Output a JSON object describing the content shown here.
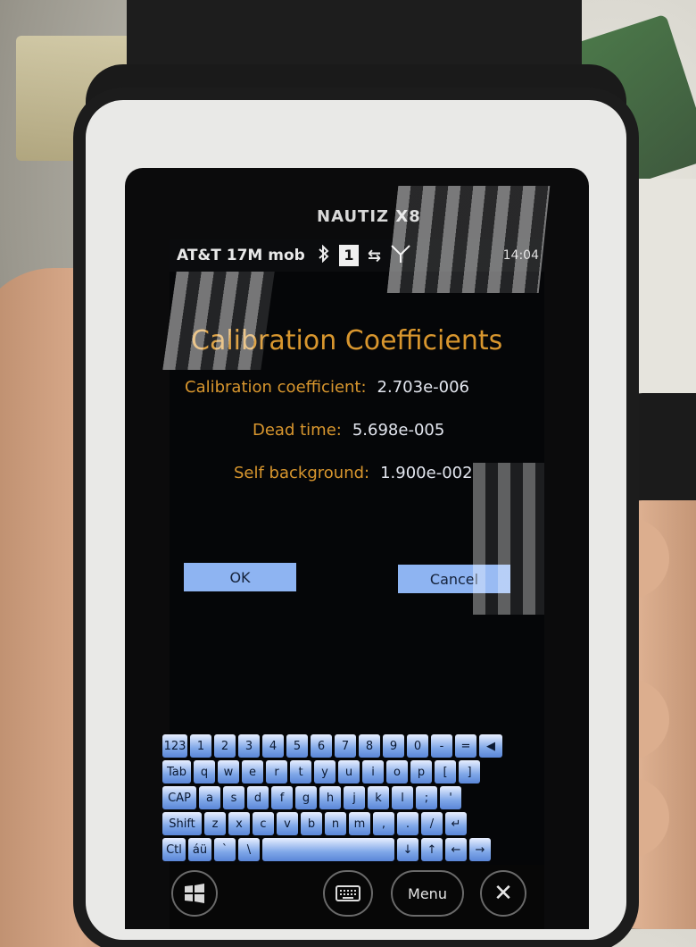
{
  "device": {
    "brand": "NAUTIZ X8"
  },
  "status_bar": {
    "carrier": "AT&T 17M mob",
    "bluetooth_icon": "bluetooth-icon",
    "notification_count": "1",
    "data_icon": "data-transfer-icon",
    "signal_icon": "signal-icon",
    "time": "14:04"
  },
  "dialog": {
    "title": "Calibration Coefficients",
    "fields": [
      {
        "label": "Calibration coefficient:",
        "value": "2.703e-006"
      },
      {
        "label": "Dead time:",
        "value": "5.698e-005"
      },
      {
        "label": "Self background:",
        "value": "1.900e-002"
      }
    ],
    "ok_label": "OK",
    "cancel_label": "Cancel"
  },
  "keyboard": {
    "row1": [
      "123",
      "1",
      "2",
      "3",
      "4",
      "5",
      "6",
      "7",
      "8",
      "9",
      "0",
      "-",
      "=",
      "◀"
    ],
    "row2": [
      "Tab",
      "q",
      "w",
      "e",
      "r",
      "t",
      "y",
      "u",
      "i",
      "o",
      "p",
      "[",
      "]"
    ],
    "row3": [
      "CAP",
      "a",
      "s",
      "d",
      "f",
      "g",
      "h",
      "j",
      "k",
      "l",
      ";",
      "'"
    ],
    "row4": [
      "Shift",
      "z",
      "x",
      "c",
      "v",
      "b",
      "n",
      "m",
      ",",
      ".",
      "/",
      "↵"
    ],
    "row5": [
      "Ctl",
      "áü",
      "`",
      "\\",
      " ",
      "↓",
      "↑",
      "←",
      "→"
    ]
  },
  "softkeys": {
    "start_icon": "windows-start-icon",
    "keyboard_icon": "keyboard-icon",
    "menu_label": "Menu",
    "close_label": "✕"
  },
  "colors": {
    "accent_text": "#d8962e",
    "button": "#8eb4f2",
    "keys": "#7fa7e8"
  }
}
